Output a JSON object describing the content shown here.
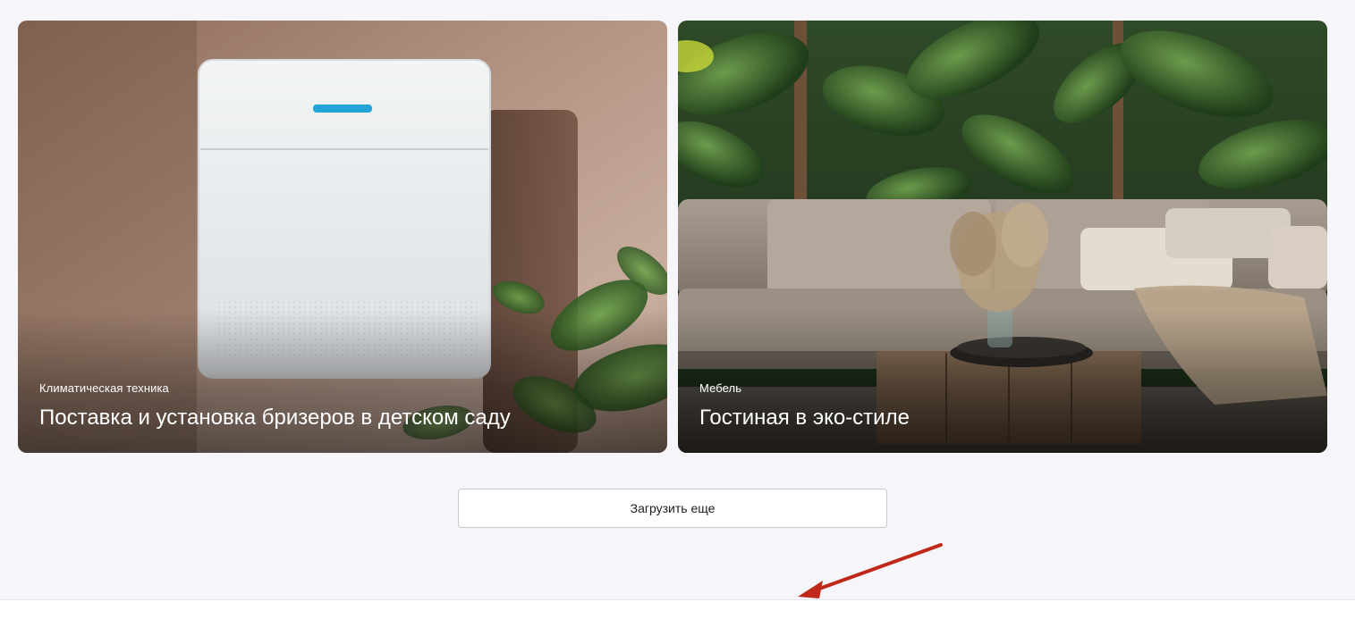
{
  "projects": [
    {
      "category": "Климатическая техника",
      "title": "Поставка и установка бризеров в детском саду",
      "image": "wall-mounted-air-breather-photo"
    },
    {
      "category": "Мебель",
      "title": "Гостиная в эко-стиле",
      "image": "eco-style-living-room-photo"
    }
  ],
  "load_more": {
    "label": "Загрузить еще"
  },
  "annotation": {
    "icon": "red-arrow-icon",
    "color": "#c0291a"
  },
  "colors": {
    "page_background": "#f6f6fa",
    "button_border": "#c9c9d1",
    "footer_background": "#ffffff"
  }
}
